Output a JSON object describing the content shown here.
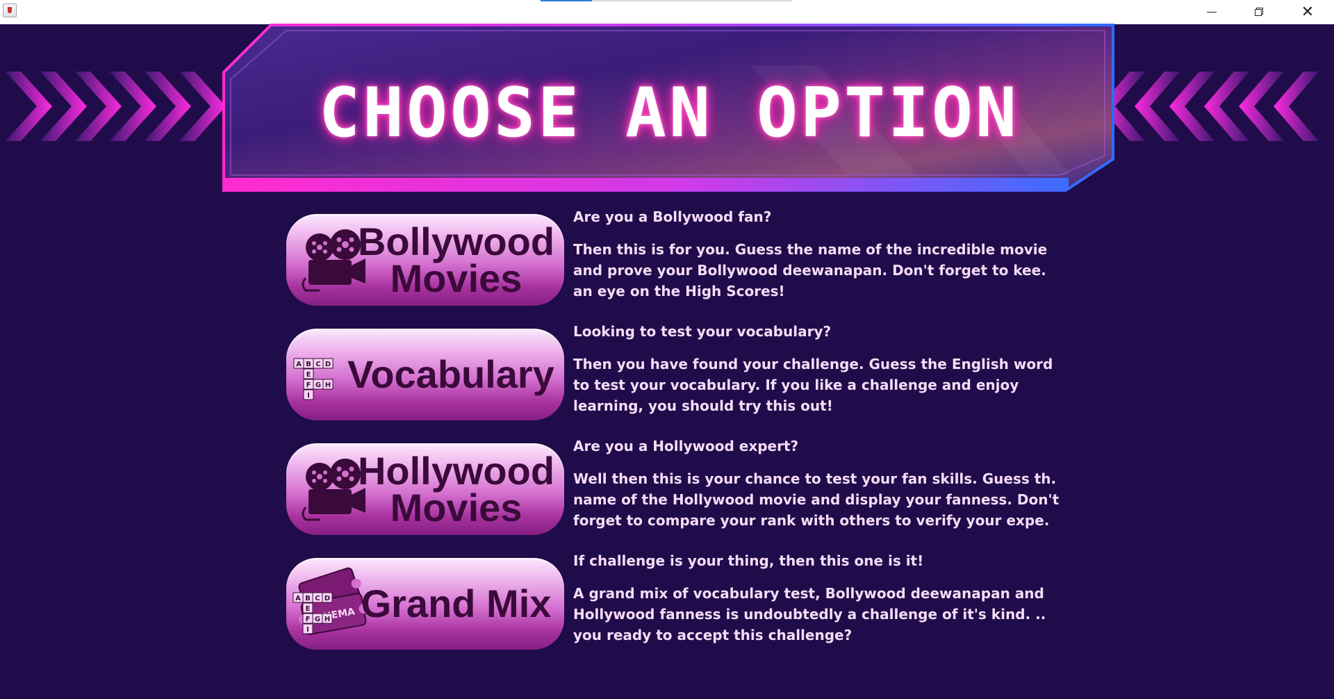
{
  "window": {
    "minimize_label": "—",
    "close_label": "✕"
  },
  "banner": {
    "title": "CHOOSE AN OPTION"
  },
  "options": [
    {
      "line1": "Bollywood",
      "line2": "Movies",
      "icon": "movie-camera-icon",
      "question": "Are you a Bollywood fan?",
      "description": "Then this is for you. Guess the name of the incredible movie\nand prove your Bollywood deewanapan. Don't forget to kee.\nan eye on the High Scores!"
    },
    {
      "line1": "Vocabulary",
      "line2": "",
      "icon": "crossword-letters-icon",
      "letters": [
        "A",
        "B",
        "C",
        "D",
        "E",
        "F",
        "G",
        "H",
        "I"
      ],
      "question": "Looking to test your vocabulary?",
      "description": "Then you have found your challenge. Guess the English word\nto test your vocabulary. If you like a challenge and enjoy\nlearning, you should try this out!"
    },
    {
      "line1": "Hollywood",
      "line2": "Movies",
      "icon": "movie-camera-icon",
      "question": "Are you a Hollywood expert?",
      "description": "Well then this is your chance to test your fan skills. Guess th.\nname of the Hollywood movie and display your fanness. Don't\nforget to compare your rank with others to verify your expe."
    },
    {
      "line1": "Grand Mix",
      "line2": "",
      "icon": "cinema-tickets-icon",
      "ticket_text": "CINEMA",
      "question": "If challenge is your thing, then this one is it!",
      "description": "A grand mix of vocabulary test, Bollywood deewanapan and\nHollywood fanness is undoubtedly a challenge of it's kind.  ..\nyou ready to accept this challenge?"
    }
  ],
  "colors": {
    "background": "#200c4a",
    "neon_pink": "#ff2bd0",
    "neon_blue": "#2f6bff",
    "text": "#f6dcf6",
    "pill_text": "#3a0a3a"
  }
}
